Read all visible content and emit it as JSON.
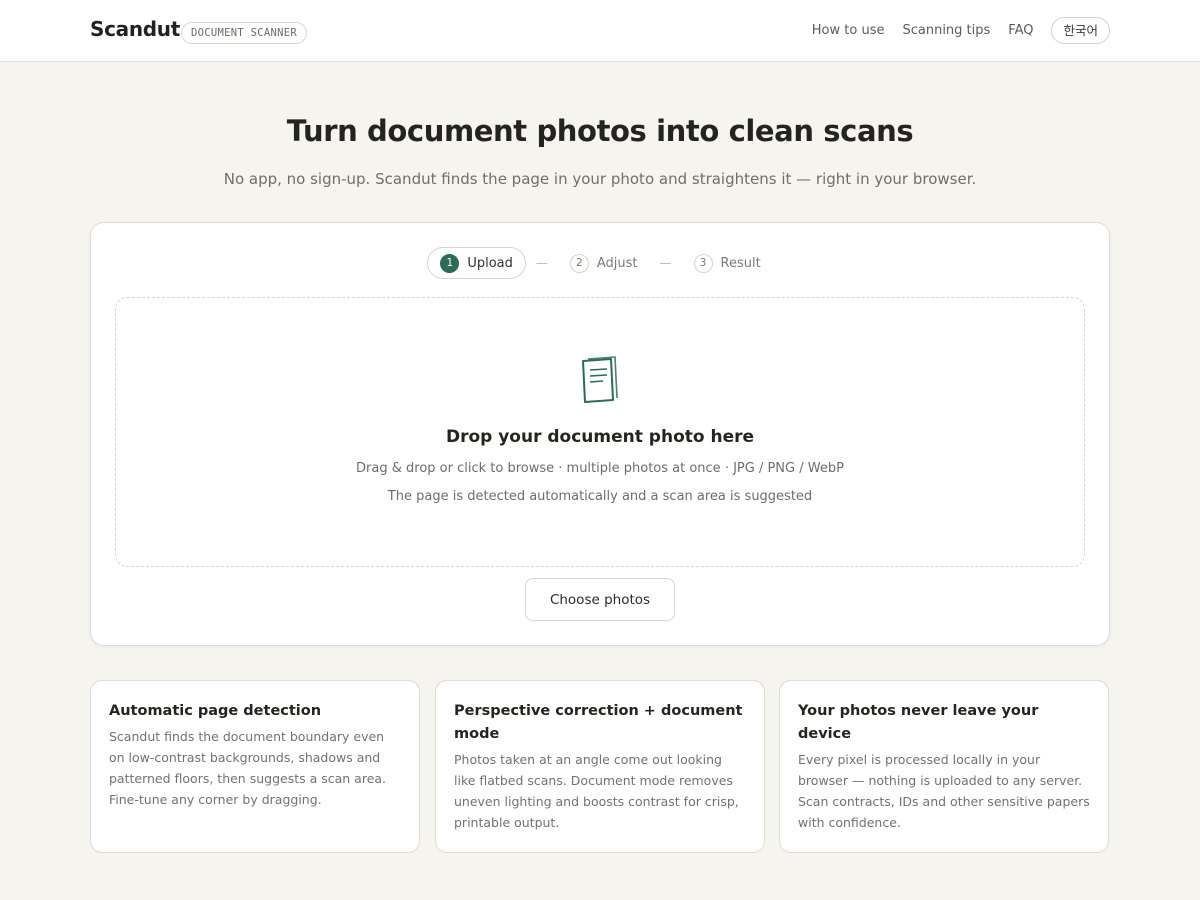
{
  "header": {
    "brand": "Scandut",
    "tag": "DOCUMENT SCANNER",
    "nav": [
      "How to use",
      "Scanning tips",
      "FAQ"
    ],
    "language_button": "한국어"
  },
  "hero": {
    "title": "Turn document photos into clean scans",
    "subtitle": "No app, no sign-up. Scandut finds the page in your photo and straightens it — right in your browser."
  },
  "steps": [
    {
      "number": "1",
      "label": "Upload",
      "active": true
    },
    {
      "number": "2",
      "label": "Adjust",
      "active": false
    },
    {
      "number": "3",
      "label": "Result",
      "active": false
    }
  ],
  "step_separator": "—",
  "dropzone": {
    "icon": "document-icon",
    "title": "Drop your document photo here",
    "line1": "Drag & drop or click to browse · multiple photos at once · JPG / PNG / WebP",
    "line2": "The page is detected automatically and a scan area is suggested"
  },
  "choose_button": "Choose photos",
  "features": [
    {
      "title": "Automatic page detection",
      "body": "Scandut finds the document boundary even on low-contrast backgrounds, shadows and patterned floors, then suggests a scan area. Fine-tune any corner by dragging."
    },
    {
      "title": "Perspective correction + document mode",
      "body": "Photos taken at an angle come out looking like flatbed scans. Document mode removes uneven lighting and boosts contrast for crisp, printable output."
    },
    {
      "title": "Your photos never leave your device",
      "body": "Every pixel is processed locally in your browser — nothing is uploaded to any server. Scan contracts, IDs and other sensitive papers with confidence."
    }
  ],
  "colors": {
    "accent": "#2c6b56",
    "background": "#f5f4ef",
    "card": "#ffffff"
  }
}
